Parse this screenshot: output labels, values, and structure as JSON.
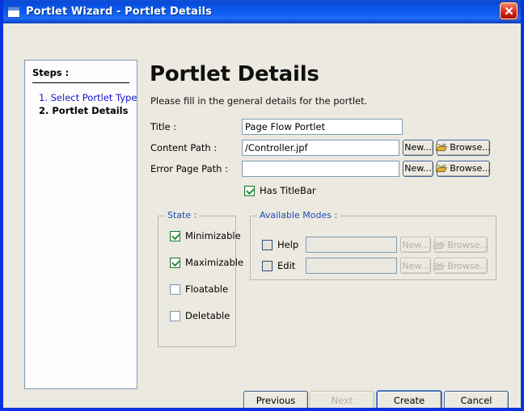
{
  "window": {
    "title": "Portlet Wizard - Portlet Details",
    "icon": "window-icon",
    "close_label": "✕"
  },
  "steps_panel": {
    "heading": "Steps :",
    "items": [
      {
        "label": "1. Select Portlet Type",
        "state": "link"
      },
      {
        "label": "2. Portlet Details",
        "state": "current"
      }
    ]
  },
  "main": {
    "title": "Portlet Details",
    "subtitle": "Please fill in the general details for the portlet.",
    "fields": [
      {
        "label": "Title :",
        "value": "Page Flow Portlet",
        "placeholder": "",
        "enabled": true,
        "has_buttons": false
      },
      {
        "label": "Content Path :",
        "value": "/Controller.jpf",
        "placeholder": "",
        "enabled": true,
        "has_buttons": true,
        "new_label": "New...",
        "browse_label": "Browse..."
      },
      {
        "label": "Error Page Path :",
        "value": "",
        "placeholder": "",
        "enabled": true,
        "has_buttons": true,
        "new_label": "New...",
        "browse_label": "Browse..."
      }
    ],
    "has_titlebar": {
      "label": "Has TitleBar",
      "checked": true
    }
  },
  "state_group": {
    "legend": "State :",
    "items": [
      {
        "label": "Minimizable",
        "checked": true
      },
      {
        "label": "Maximizable",
        "checked": true
      },
      {
        "label": "Floatable",
        "checked": false
      },
      {
        "label": "Deletable",
        "checked": false
      }
    ]
  },
  "modes_group": {
    "legend": "Available Modes :",
    "rows": [
      {
        "label": "Help",
        "checked": false,
        "value": "",
        "new_label": "New...",
        "browse_label": "Browse...",
        "enabled": false
      },
      {
        "label": "Edit",
        "checked": false,
        "value": "",
        "new_label": "New...",
        "browse_label": "Browse...",
        "enabled": false
      }
    ]
  },
  "footer": {
    "previous_label": "Previous",
    "next_label": "Next",
    "create_label": "Create",
    "cancel_label": "Cancel"
  },
  "colors": {
    "titlebar_blue": "#0d5cf4",
    "frame_blue": "#0634e0",
    "dialog_bg": "#ece9e0",
    "legend_blue": "#1b4bb5",
    "link_blue": "#1414cc",
    "check_green": "#2a8b36",
    "close_red": "#c61a0d"
  }
}
